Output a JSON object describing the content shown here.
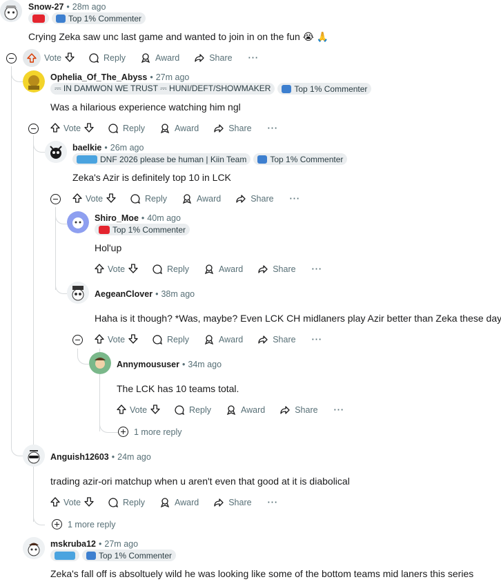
{
  "comments": [
    {
      "user": "Snow-27",
      "time": "28m ago",
      "flairs": [
        {
          "text": "",
          "icon_color": "#e4252f"
        },
        {
          "text": "Top 1% Commenter",
          "icon_color": "#3d7fcf"
        }
      ],
      "text": "Crying Zeka saw unc last game and wanted to join in on the fun 😭 🙏"
    },
    {
      "user": "Ophelia_Of_The_Abyss",
      "time": "27m ago",
      "flairs": [
        {
          "text": "⎓ IN DAMWON WE TRUST ⎓ HUNI/DEFT/SHOWMAKER",
          "icon_color": ""
        },
        {
          "text": "Top 1% Commenter",
          "icon_color": "#3d7fcf"
        }
      ],
      "text": "Was a hilarious experience watching him ngl"
    },
    {
      "user": "baelkie",
      "time": "26m ago",
      "flairs": [
        {
          "text": "DNF 2026 please be human | Kiin Team",
          "icon_color": "#4aa3df"
        },
        {
          "text": "Top 1% Commenter",
          "icon_color": "#3d7fcf"
        }
      ],
      "text": "Zeka's Azir is definitely top 10 in LCK"
    },
    {
      "user": "Shiro_Moe",
      "time": "40m ago",
      "flairs": [
        {
          "text": "Top 1% Commenter",
          "icon_color": "#3d7fcf"
        }
      ],
      "text": "Hol'up"
    },
    {
      "user": "AegeanClover",
      "time": "38m ago",
      "flairs": [],
      "text": "Haha is it though? *Was, maybe? Even LCK CH midlaners play Azir better than Zeka these days."
    },
    {
      "user": "Annymoususer",
      "time": "34m ago",
      "flairs": [],
      "text": "The LCK has 10 teams total."
    },
    {
      "user": "Anguish12603",
      "time": "24m ago",
      "flairs": [],
      "text": "trading azir-ori matchup when u aren't even that good at it is diabolical"
    },
    {
      "user": "mskruba12",
      "time": "27m ago",
      "flairs": [
        {
          "text": "",
          "icon_color": "#4aa3df"
        },
        {
          "text": "Top 1% Commenter",
          "icon_color": "#3d7fcf"
        }
      ],
      "text": "Zeka's fall off is absoltuely wild he was looking like some of the bottom teams mid laners this series"
    }
  ],
  "actions": {
    "vote": "Vote",
    "reply": "Reply",
    "award": "Award",
    "share": "Share",
    "more": "···"
  },
  "more_replies": {
    "label": "1 more reply"
  },
  "colors": {
    "upvote_active": "#d93a00",
    "muted": "#576f76",
    "flair_bg": "#eaedef"
  }
}
